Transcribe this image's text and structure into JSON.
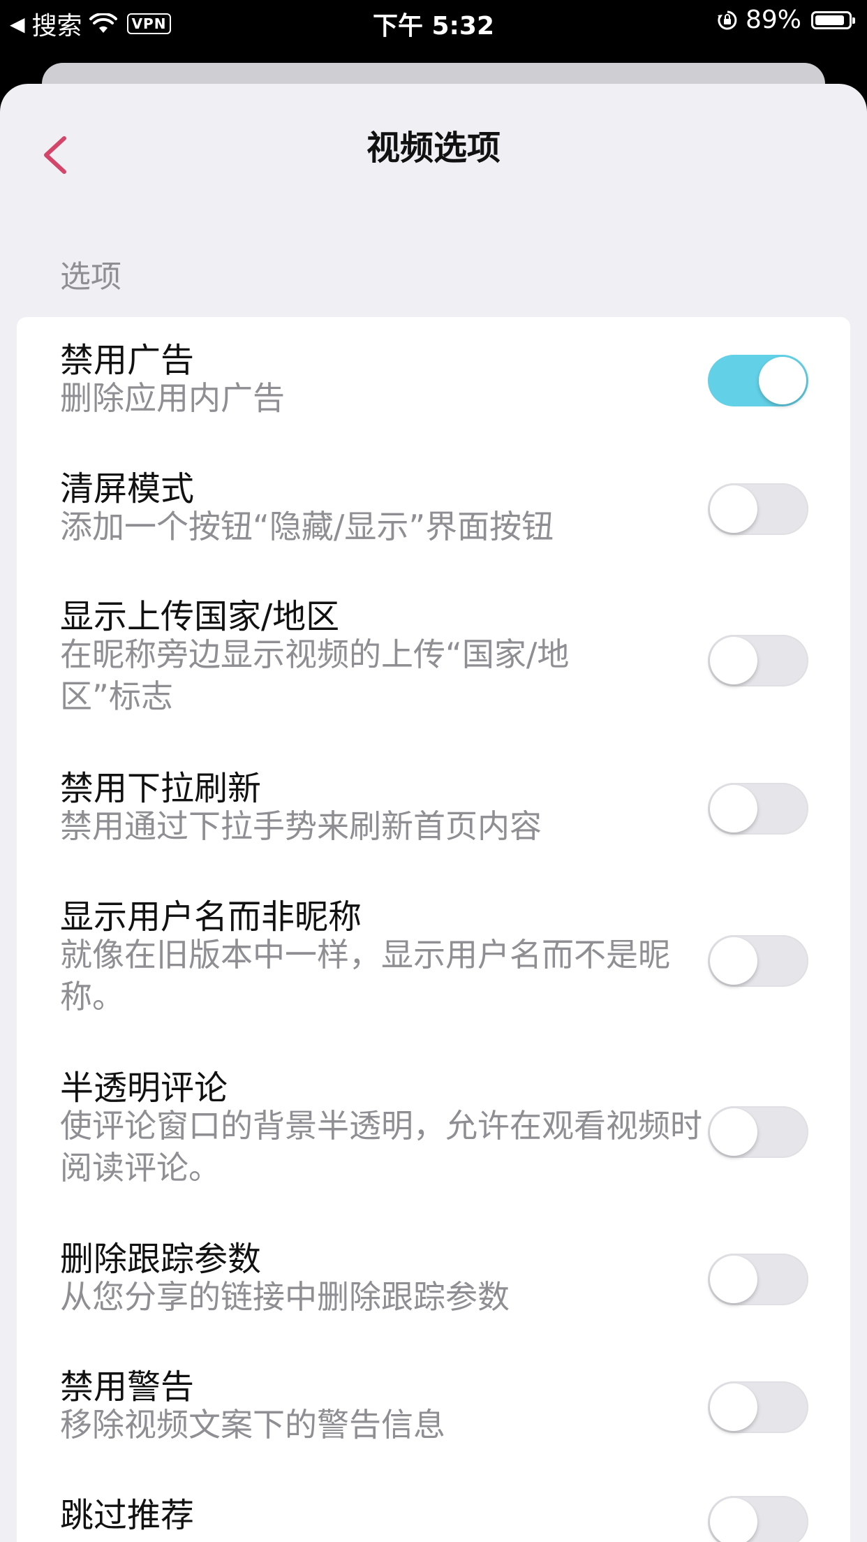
{
  "status_bar": {
    "back_app": "搜索",
    "vpn": "VPN",
    "time": "下午 5:32",
    "battery": "89%",
    "battery_level": 0.89
  },
  "nav": {
    "title": "视频选项"
  },
  "section": {
    "header": "选项"
  },
  "colors": {
    "accent_back": "#d4456a",
    "toggle_on": "#62d0e6",
    "toggle_off": "#e5e5ea"
  },
  "settings": [
    {
      "title": "禁用广告",
      "subtitle": "删除应用内广告",
      "enabled": true
    },
    {
      "title": "清屏模式",
      "subtitle": "添加一个按钮“隐藏/显示”界面按钮",
      "enabled": false
    },
    {
      "title": "显示上传国家/地区",
      "subtitle": "在昵称旁边显示视频的上传“国家/地区”标志",
      "enabled": false
    },
    {
      "title": "禁用下拉刷新",
      "subtitle": "禁用通过下拉手势来刷新首页内容",
      "enabled": false
    },
    {
      "title": "显示用户名而非昵称",
      "subtitle": "就像在旧版本中一样，显示用户名而不是昵称。",
      "enabled": false
    },
    {
      "title": "半透明评论",
      "subtitle": "使评论窗口的背景半透明，允许在观看视频时阅读评论。",
      "enabled": false
    },
    {
      "title": "删除跟踪参数",
      "subtitle": "从您分享的链接中删除跟踪参数",
      "enabled": false
    },
    {
      "title": "禁用警告",
      "subtitle": "移除视频文案下的警告信息",
      "enabled": false
    },
    {
      "title": "跳过推荐",
      "subtitle": "",
      "enabled": false
    }
  ]
}
